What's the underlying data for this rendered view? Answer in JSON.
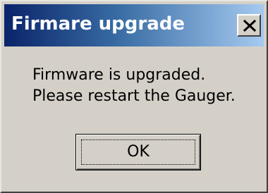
{
  "window": {
    "title": "Firmare upgrade",
    "close_icon": "close-icon",
    "titlebar_color_start": "#0a246a",
    "titlebar_color_end": "#a6caf0",
    "face_color": "#d4d0c8"
  },
  "message": {
    "line1": "Firmware is upgraded.",
    "line2": "Please restart the Gauger."
  },
  "buttons": {
    "ok_label": "OK"
  }
}
